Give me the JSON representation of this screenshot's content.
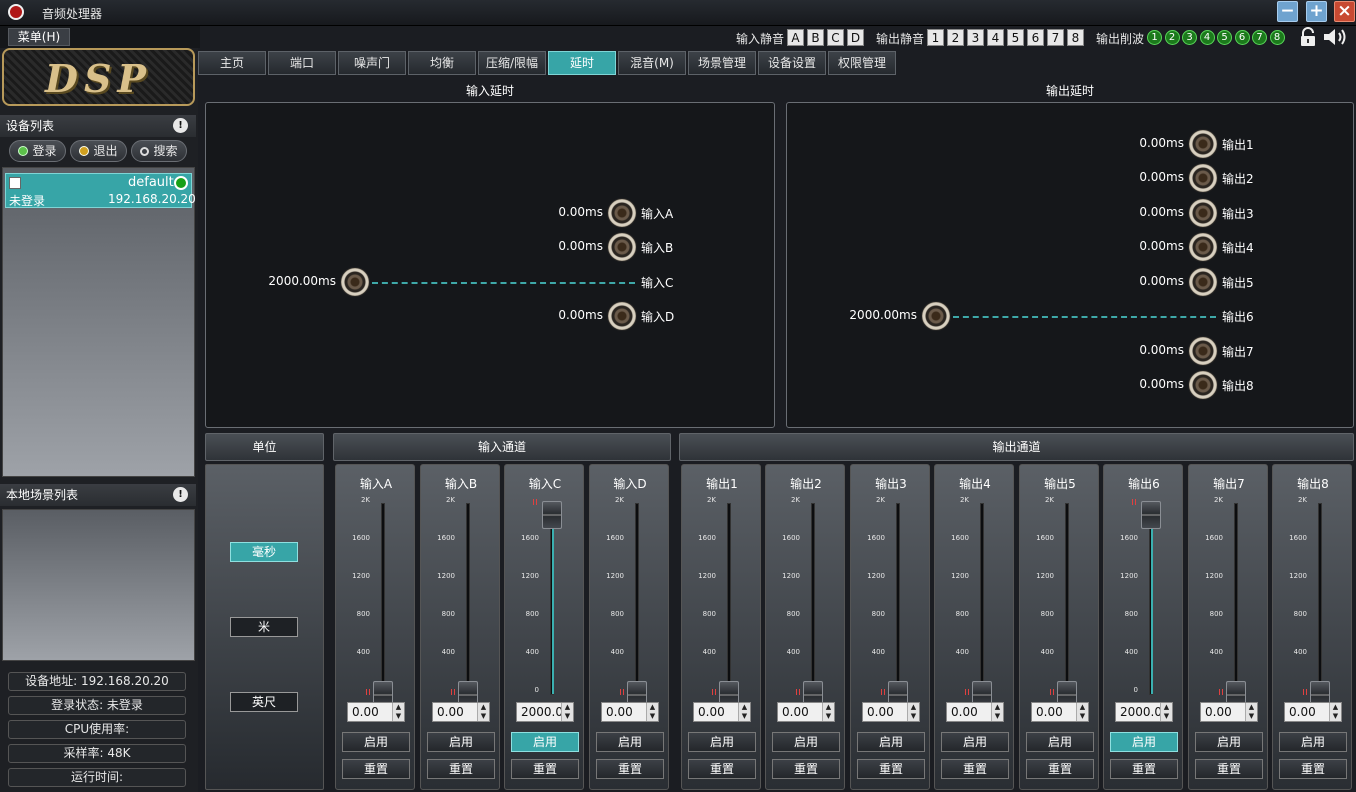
{
  "app": {
    "title": "音频处理器",
    "menu": "菜单(H)"
  },
  "window_controls": {
    "minimize": "−",
    "maximize": "+",
    "close": "×"
  },
  "toolbar": {
    "input_mute_label": "输入静音",
    "input_mute": [
      "A",
      "B",
      "C",
      "D"
    ],
    "output_mute_label": "输出静音",
    "output_mute": [
      "1",
      "2",
      "3",
      "4",
      "5",
      "6",
      "7",
      "8"
    ],
    "clip_label": "输出削波",
    "clip": [
      "1",
      "2",
      "3",
      "4",
      "5",
      "6",
      "7",
      "8"
    ]
  },
  "tabs": [
    "主页",
    "端口",
    "噪声门",
    "均衡",
    "压缩/限幅",
    "延时",
    "混音(M)",
    "场景管理",
    "设备设置",
    "权限管理"
  ],
  "active_tab": "延时",
  "logo": "DSP",
  "sidebar": {
    "device_list_title": "设备列表",
    "buttons": {
      "login": "登录",
      "logout": "退出",
      "search": "搜索"
    },
    "device": {
      "name": "default",
      "status": "未登录",
      "ip": "192.168.20.20"
    },
    "scene_list_title": "本地场景列表",
    "status": {
      "address": "设备地址: 192.168.20.20",
      "login_state": "登录状态: 未登录",
      "cpu": "CPU使用率:",
      "sample_rate": "采样率: 48K",
      "runtime": "运行时间:"
    }
  },
  "input_delay": {
    "title": "输入延时",
    "channels": [
      {
        "name": "输入A",
        "value": "0.00ms"
      },
      {
        "name": "输入B",
        "value": "0.00ms"
      },
      {
        "name": "输入C",
        "value": "2000.00ms"
      },
      {
        "name": "输入D",
        "value": "0.00ms"
      }
    ]
  },
  "output_delay": {
    "title": "输出延时",
    "channels": [
      {
        "name": "输出1",
        "value": "0.00ms"
      },
      {
        "name": "输出2",
        "value": "0.00ms"
      },
      {
        "name": "输出3",
        "value": "0.00ms"
      },
      {
        "name": "输出4",
        "value": "0.00ms"
      },
      {
        "name": "输出5",
        "value": "0.00ms"
      },
      {
        "name": "输出6",
        "value": "2000.00ms"
      },
      {
        "name": "输出7",
        "value": "0.00ms"
      },
      {
        "name": "输出8",
        "value": "0.00ms"
      }
    ]
  },
  "unit": {
    "title": "单位",
    "options": [
      "毫秒",
      "米",
      "英尺"
    ],
    "selected": "毫秒"
  },
  "input_channel_title": "输入通道",
  "output_channel_title": "输出通道",
  "fader_scale": [
    "2K",
    "1600",
    "1200",
    "800",
    "400",
    "0"
  ],
  "fader_max": 2000,
  "enable_label": "启用",
  "reset_label": "重置",
  "strips": [
    {
      "name": "输入A",
      "value": "0.00",
      "level": 0,
      "enabled": false
    },
    {
      "name": "输入B",
      "value": "0.00",
      "level": 0,
      "enabled": false
    },
    {
      "name": "输入C",
      "value": "2000.00",
      "level": 2000,
      "enabled": true
    },
    {
      "name": "输入D",
      "value": "0.00",
      "level": 0,
      "enabled": false
    },
    {
      "name": "输出1",
      "value": "0.00",
      "level": 0,
      "enabled": false
    },
    {
      "name": "输出2",
      "value": "0.00",
      "level": 0,
      "enabled": false
    },
    {
      "name": "输出3",
      "value": "0.00",
      "level": 0,
      "enabled": false
    },
    {
      "name": "输出4",
      "value": "0.00",
      "level": 0,
      "enabled": false
    },
    {
      "name": "输出5",
      "value": "0.00",
      "level": 0,
      "enabled": false
    },
    {
      "name": "输出6",
      "value": "2000.00",
      "level": 2000,
      "enabled": true
    },
    {
      "name": "输出7",
      "value": "0.00",
      "level": 0,
      "enabled": false
    },
    {
      "name": "输出8",
      "value": "0.00",
      "level": 0,
      "enabled": false
    }
  ]
}
